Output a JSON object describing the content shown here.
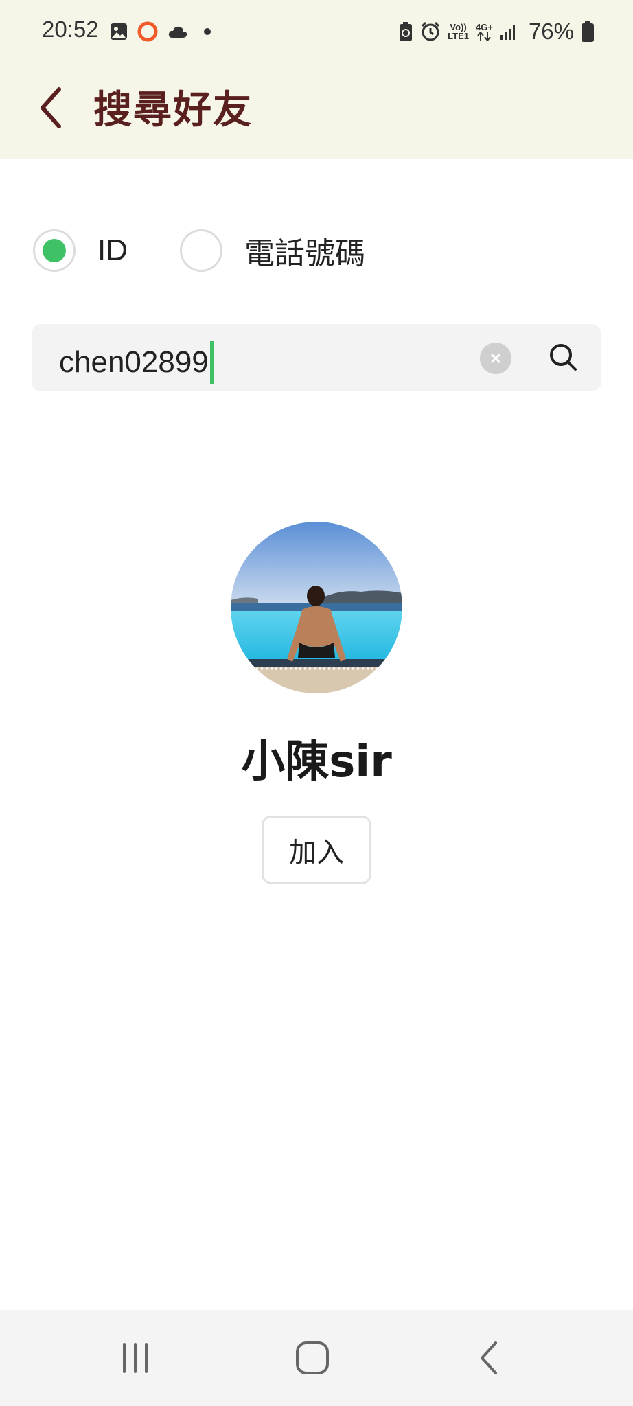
{
  "status_bar": {
    "time": "20:52",
    "battery_percent": "76%",
    "network_volte_top": "Vo))",
    "network_volte_bottom": "LTE1",
    "network_4g": "4G+",
    "left_icons": [
      "gallery-icon",
      "record-circle-icon",
      "cloud-icon",
      "dot-icon"
    ],
    "right_icons": [
      "battery-saver-icon",
      "alarm-icon",
      "volte-icon",
      "4g-data-icon",
      "signal-icon",
      "battery-icon"
    ]
  },
  "header": {
    "title": "搜尋好友",
    "background_color": "#f5f5e8",
    "title_color": "#5a1f1f"
  },
  "search_type": {
    "options": [
      {
        "label": "ID",
        "selected": true
      },
      {
        "label": "電話號碼",
        "selected": false
      }
    ],
    "accent_color": "#3fc266"
  },
  "search": {
    "value": "chen02899",
    "clear_icon": "clear-icon",
    "search_icon": "search-icon"
  },
  "result": {
    "name": "小陳sir",
    "add_label": "加入",
    "avatar_icon": "profile-photo"
  },
  "nav_bar": {
    "icons": [
      "recent-apps-icon",
      "home-icon",
      "back-icon"
    ]
  }
}
